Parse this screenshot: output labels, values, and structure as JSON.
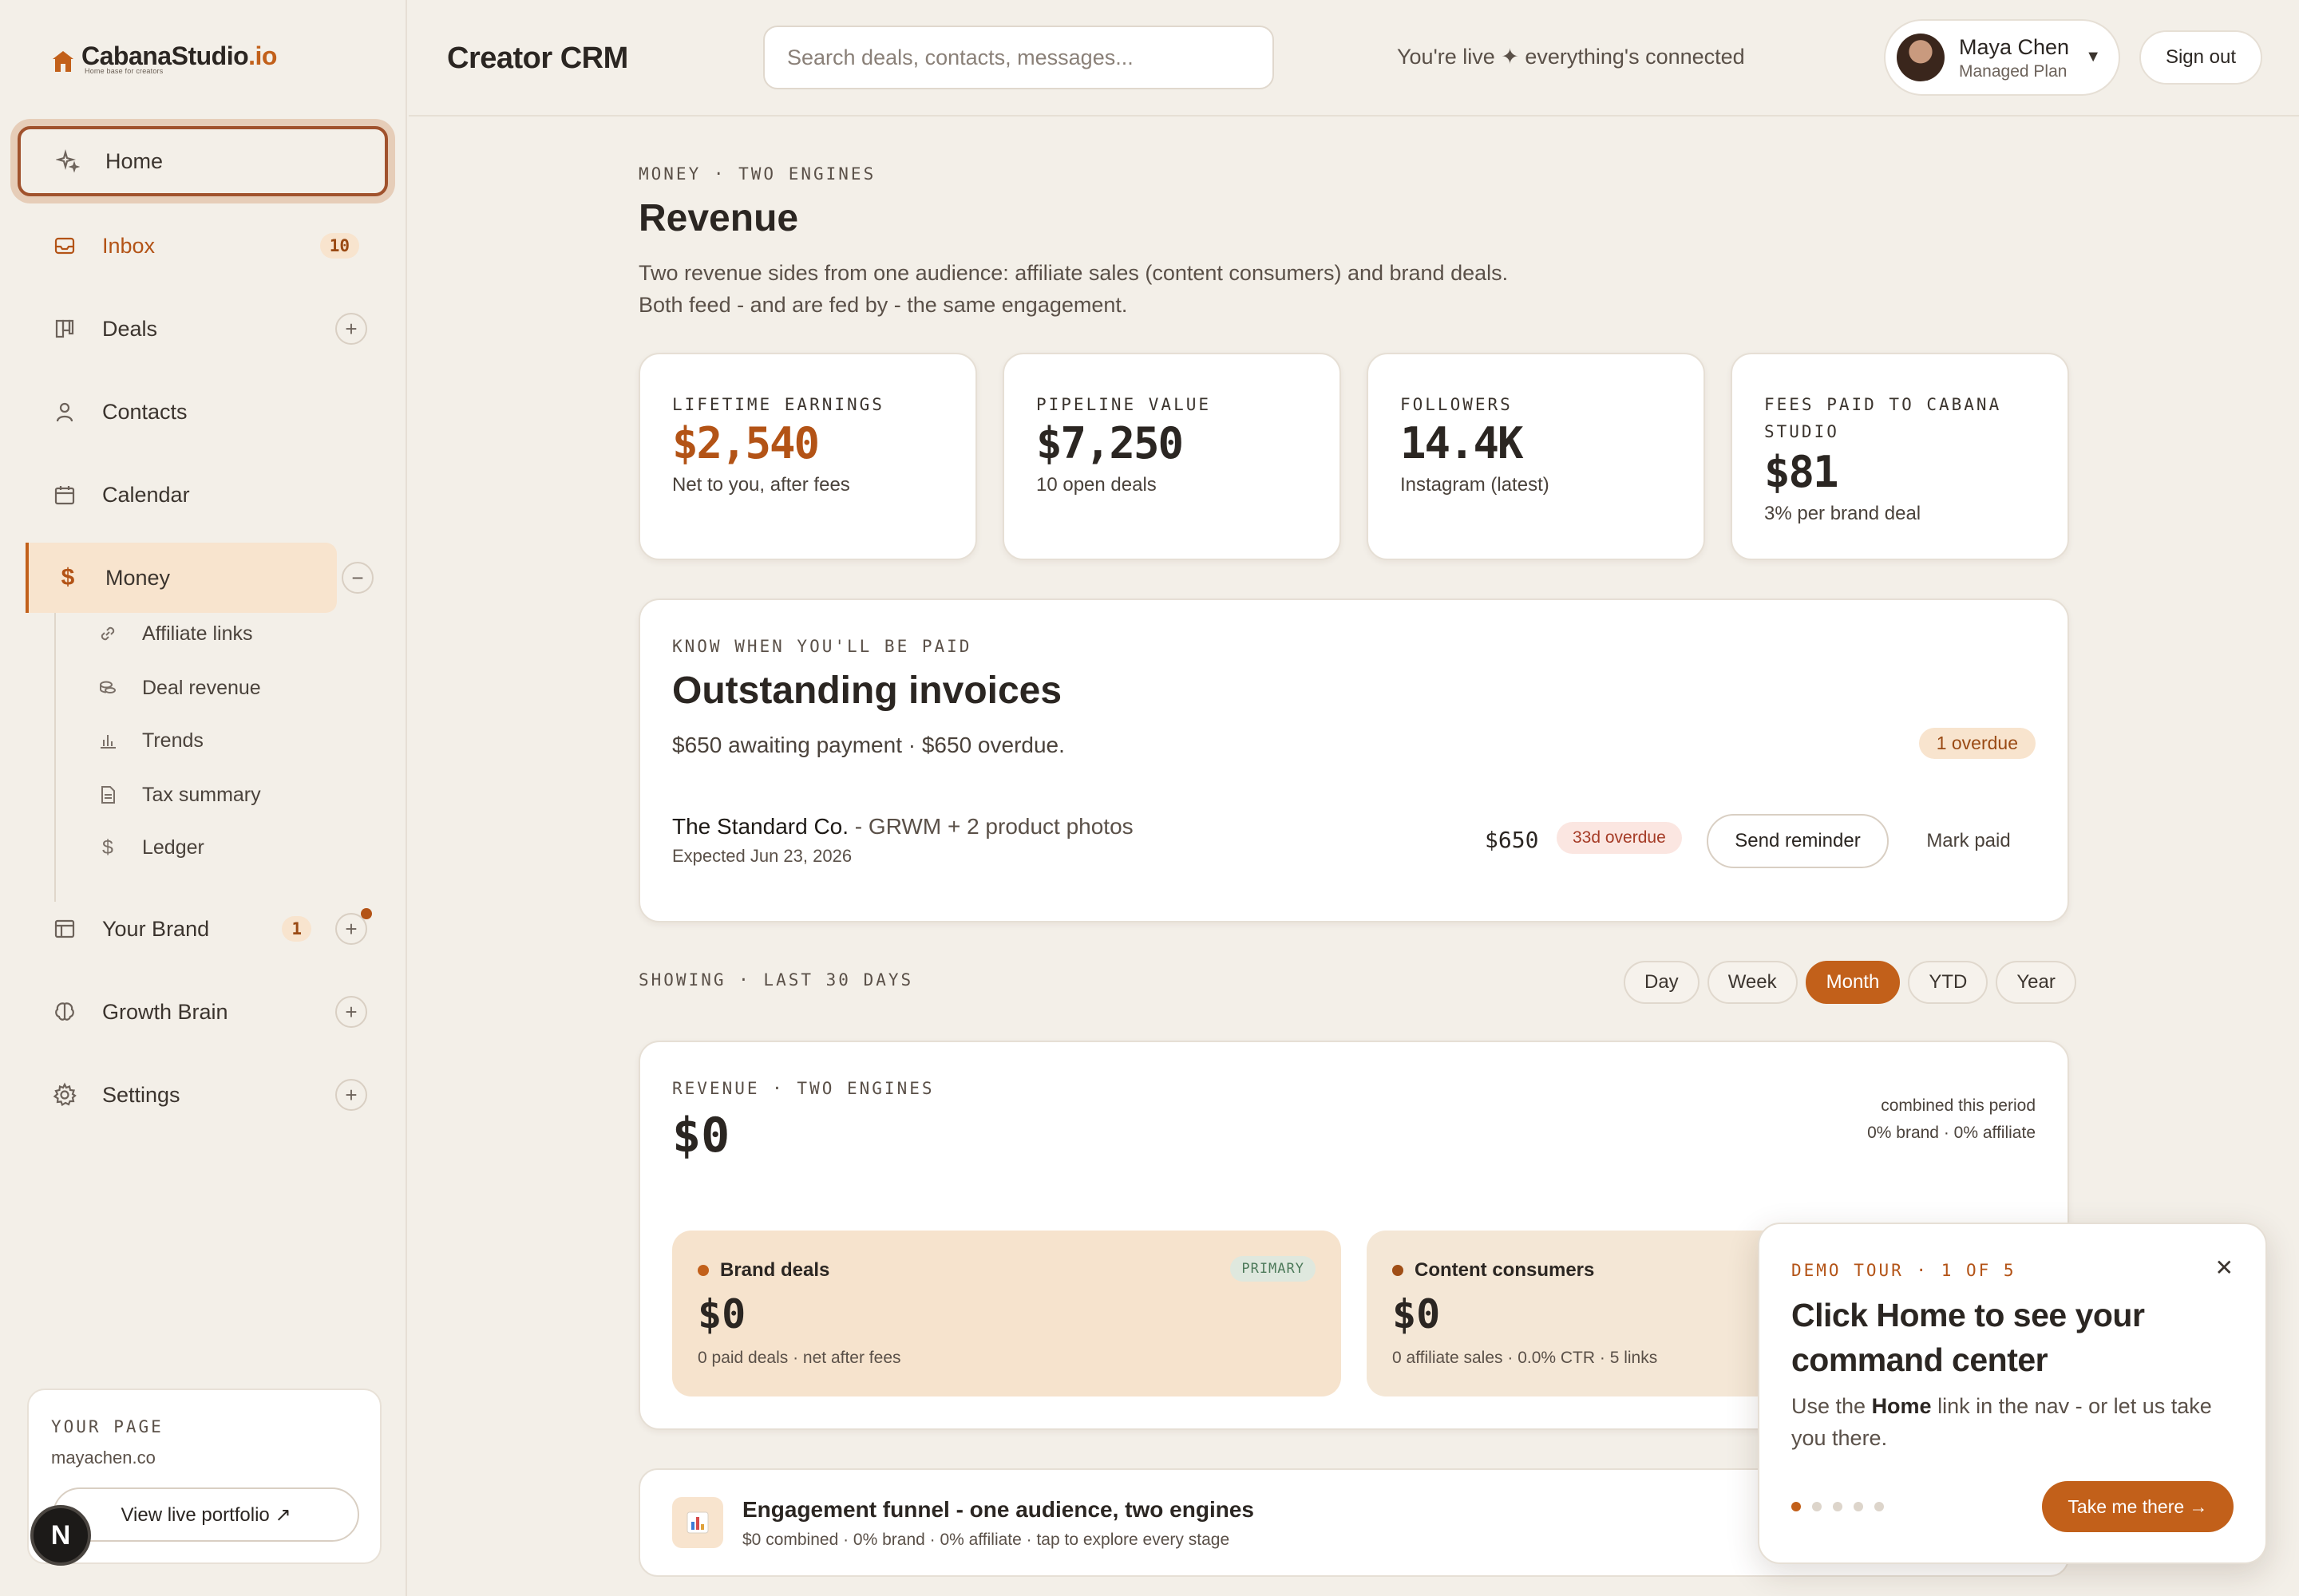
{
  "brand": {
    "name_main": "CabanaStudio",
    "name_tld": ".io",
    "tagline": "Home base for creators",
    "accent": "#c2601a"
  },
  "sidebar": {
    "items": [
      {
        "label": "Home",
        "icon": "sparkle-icon"
      },
      {
        "label": "Inbox",
        "icon": "inbox-icon",
        "badge": "10"
      },
      {
        "label": "Deals",
        "icon": "deals-icon"
      },
      {
        "label": "Contacts",
        "icon": "person-icon"
      },
      {
        "label": "Calendar",
        "icon": "calendar-icon"
      },
      {
        "label": "Money",
        "icon": "dollar-icon"
      },
      {
        "label": "Your Brand",
        "icon": "layout-icon",
        "badge": "1"
      },
      {
        "label": "Growth Brain",
        "icon": "brain-icon"
      },
      {
        "label": "Settings",
        "icon": "gear-icon"
      }
    ],
    "money_sub": [
      {
        "label": "Affiliate links",
        "icon": "link-icon"
      },
      {
        "label": "Deal revenue",
        "icon": "coins-icon"
      },
      {
        "label": "Trends",
        "icon": "bar-chart-icon"
      },
      {
        "label": "Tax summary",
        "icon": "document-icon"
      },
      {
        "label": "Ledger",
        "icon": "dollar-icon"
      }
    ],
    "your_page": {
      "title": "YOUR PAGE",
      "url": "mayachen.co",
      "button": "View live portfolio ↗"
    },
    "avatar_letter": "N"
  },
  "topbar": {
    "title": "Creator CRM",
    "search_placeholder": "Search deals, contacts, messages...",
    "status": "You're live ✦ everything's connected",
    "user_name": "Maya Chen",
    "user_plan": "Managed Plan",
    "signout": "Sign out"
  },
  "header": {
    "eyebrow": "MONEY · TWO ENGINES",
    "title": "Revenue",
    "desc1": "Two revenue sides from one audience: affiliate sales (content consumers) and brand deals.",
    "desc2": "Both feed - and are fed by - the same engagement."
  },
  "stats": [
    {
      "label": "LIFETIME EARNINGS",
      "value": "$2,540",
      "sub": "Net to you, after fees"
    },
    {
      "label": "PIPELINE VALUE",
      "value": "$7,250",
      "sub": "10 open deals"
    },
    {
      "label": "FOLLOWERS",
      "value": "14.4K",
      "sub": "Instagram (latest)"
    },
    {
      "label": "FEES PAID TO CABANA STUDIO",
      "value": "$81",
      "sub": "3% per brand deal"
    }
  ],
  "invoices": {
    "eyebrow": "KNOW WHEN YOU'LL BE PAID",
    "title": "Outstanding invoices",
    "summary": "$650 awaiting payment · $650 overdue.",
    "overdue_pill": "1 overdue",
    "row": {
      "client": "The Standard Co.",
      "desc": " - GRWM + 2 product photos",
      "expected": "Expected Jun 23, 2026",
      "amount": "$650",
      "status": "33d overdue",
      "remind": "Send reminder",
      "paid": "Mark paid"
    }
  },
  "showing": {
    "label": "SHOWING · LAST 30 DAYS",
    "periods": [
      "Day",
      "Week",
      "Month",
      "YTD",
      "Year"
    ],
    "active": "Month"
  },
  "revenue": {
    "eyebrow": "REVENUE · TWO ENGINES",
    "value": "$0",
    "right1": "combined this period",
    "right2": "0% brand · 0% affiliate",
    "brand": {
      "title": "Brand deals",
      "tag": "PRIMARY",
      "value": "$0",
      "sub": "0 paid deals · net after fees"
    },
    "content": {
      "title": "Content consumers",
      "value": "$0",
      "sub": "0 affiliate sales · 0.0% CTR · 5 links"
    }
  },
  "funnel": {
    "title": "Engagement funnel - one audience, two engines",
    "sub": "$0 combined · 0% brand · 0% affiliate · tap to explore every stage"
  },
  "tour": {
    "eyebrow": "DEMO TOUR · 1 OF 5",
    "title": "Click Home to see your command center",
    "body_pre": "Use the ",
    "body_bold": "Home",
    "body_post": " link in the nav - or let us take you there.",
    "button": "Take me there →",
    "close": "✕",
    "step": 1,
    "total": 5
  }
}
